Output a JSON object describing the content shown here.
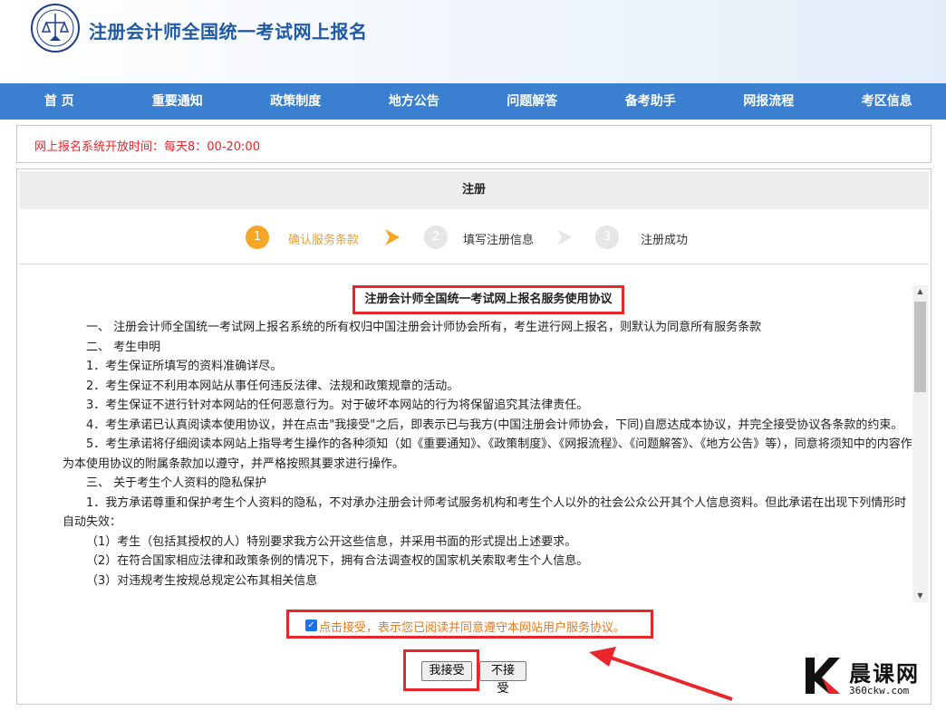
{
  "header": {
    "site_title": "注册会计师全国统一考试网上报名"
  },
  "nav": {
    "items": [
      "首 页",
      "重要通知",
      "政策制度",
      "地方公告",
      "问题解答",
      "备考助手",
      "网报流程",
      "考区信息"
    ]
  },
  "notice": {
    "text": "网上报名系统开放时间：每天8：00-20:00"
  },
  "main": {
    "title": "注册",
    "steps": [
      {
        "number": "1",
        "label": "确认服务条款",
        "state": "active"
      },
      {
        "number": "2",
        "label": "填写注册信息",
        "state": "inactive"
      },
      {
        "number": "3",
        "label": "注册成功",
        "state": "inactive"
      }
    ]
  },
  "agreement": {
    "title": "注册会计师全国统一考试网上报名服务使用协议",
    "paragraphs": [
      "一、 注册会计师全国统一考试网上报名系统的所有权归中国注册会计师协会所有，考生进行网上报名，则默认为同意所有服务条款",
      "二、 考生申明",
      "1．考生保证所填写的资料准确详尽。",
      "2．考生保证不利用本网站从事任何违反法律、法规和政策规章的活动。",
      "3．考生保证不进行针对本网站的任何恶意行为。对于破坏本网站的行为将保留追究其法律责任。",
      "4．考生承诺已认真阅读本使用协议，并在点击\"我接受\"之后，即表示已与我方(中国注册会计师协会，下同)自愿达成本协议，并完全接受协议各条款的约束。",
      "5．考生承诺将仔细阅读本网站上指导考生操作的各种须知（如《重要通知》、《政策制度》、《网报流程》、《问题解答》、《地方公告》等），同意将须知中的内容作为本使用协议的附属条款加以遵守，并严格按照其要求进行操作。",
      "三、 关于考生个人资料的隐私保护",
      "1．我方承诺尊重和保护考生个人资料的隐私，不对承办注册会计师考试服务机构和考生个人以外的社会公众公开其个人信息资料。但此承诺在出现下列情形时自动失效：",
      "（1）考生（包括其授权的人）特别要求我方公开这些信息，并采用书面的形式提出上述要求。",
      "（2）在符合国家相应法律和政策条例的情况下，拥有合法调查权的国家机关索取考生个人信息。",
      "（3）对违规考生按规总规定公布其相关信息"
    ]
  },
  "accept": {
    "checked": true,
    "text": "点击接受，表示您已阅读并同意遵守本网站用户服务协议。",
    "accept_button": "我接受",
    "reject_button": "不接受"
  },
  "watermark": {
    "brand": "晨课网",
    "url": "360ckw.com"
  },
  "colors": {
    "nav_bg": "#3a7fd0",
    "title_blue": "#1f5aa6",
    "highlight_red": "#e8262c",
    "step_active": "#f5a623",
    "step_inactive": "#e6e6e6",
    "accept_text": "#e87a1c"
  }
}
